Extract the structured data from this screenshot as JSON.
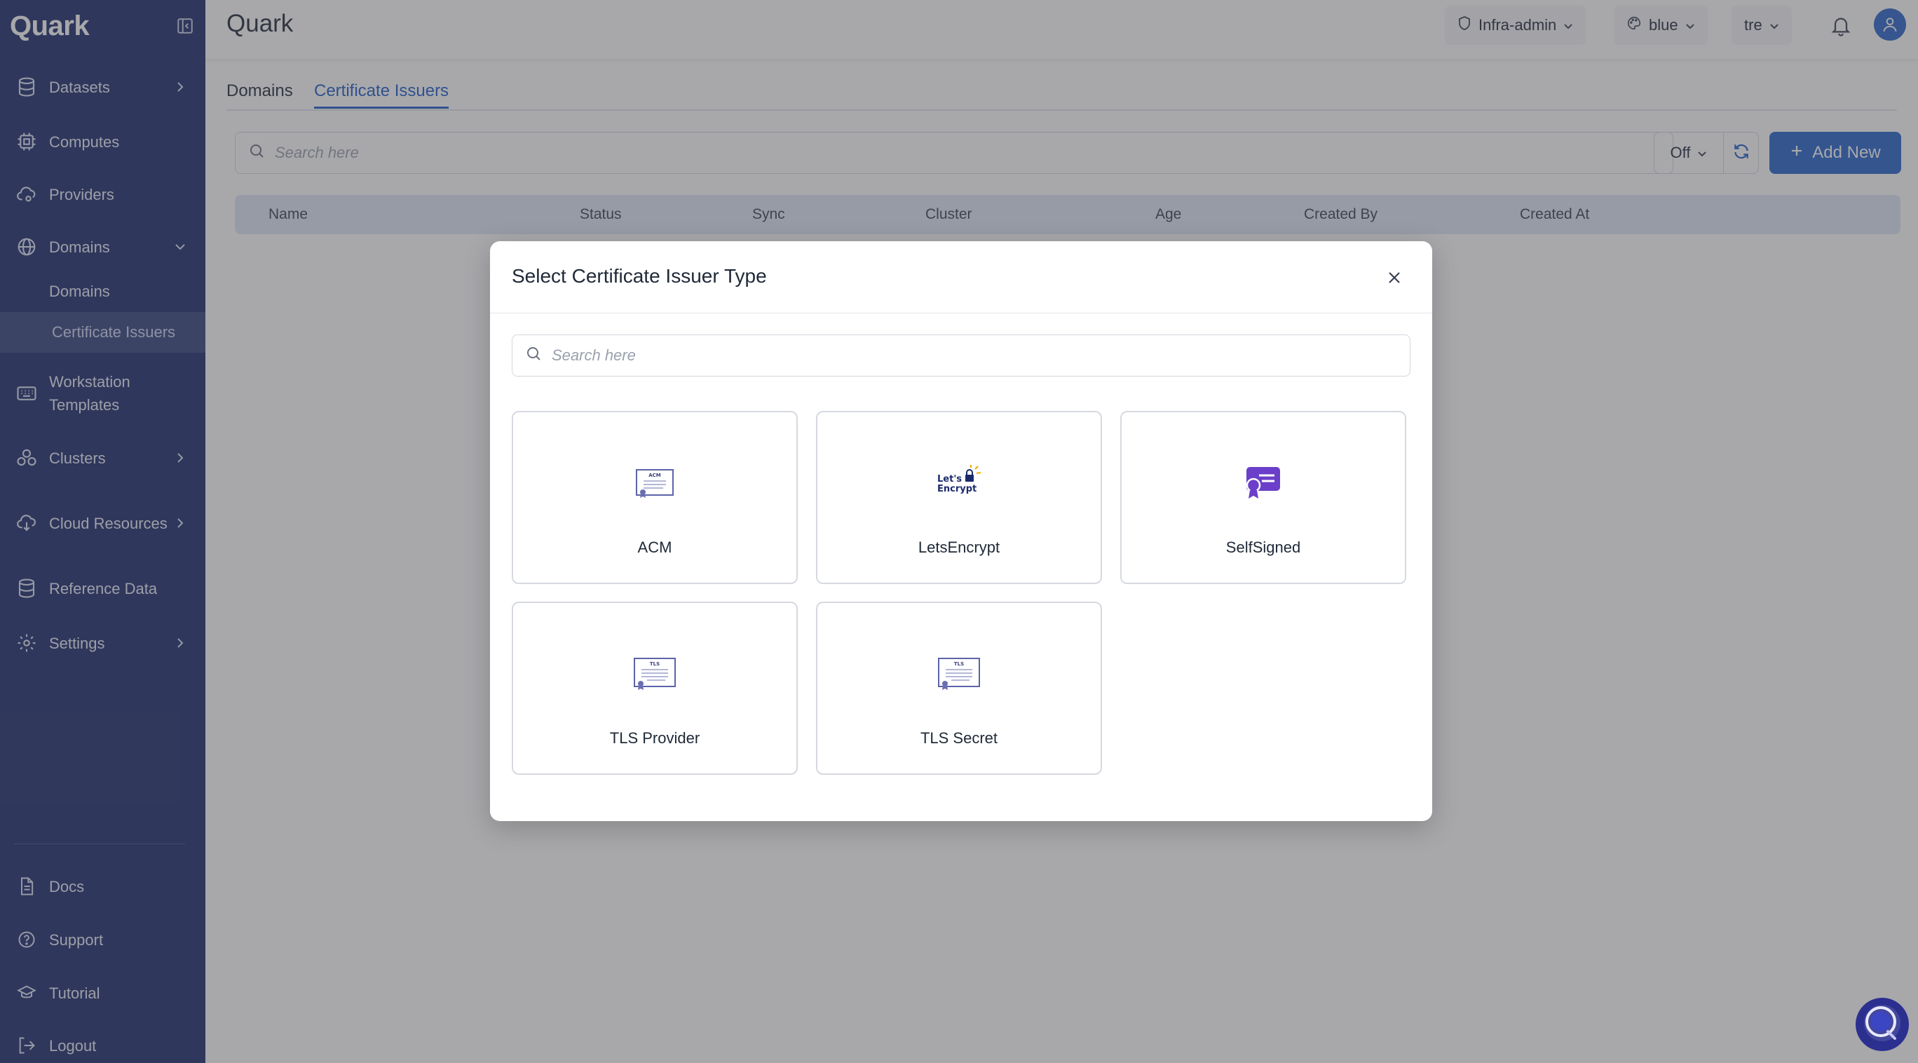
{
  "app": {
    "name": "Quark"
  },
  "sidebar": {
    "items": [
      {
        "label": "Datasets",
        "icon": "database-icon"
      },
      {
        "label": "Computes",
        "icon": "cpu-icon"
      },
      {
        "label": "Providers",
        "icon": "cloud-settings-icon"
      },
      {
        "label": "Domains",
        "icon": "globe-icon"
      },
      {
        "label": "Workstation Templates",
        "icon": "keyboard-icon"
      },
      {
        "label": "Clusters",
        "icon": "cluster-icon"
      },
      {
        "label": "Cloud Resources",
        "icon": "cloud-download-icon"
      },
      {
        "label": "Reference Data",
        "icon": "database-icon"
      },
      {
        "label": "Settings",
        "icon": "gear-icon"
      }
    ],
    "sub_items": [
      {
        "label": "Domains"
      },
      {
        "label": "Certificate Issuers"
      }
    ],
    "bottom": [
      {
        "label": "Docs",
        "icon": "document-icon"
      },
      {
        "label": "Support",
        "icon": "help-circle-icon"
      },
      {
        "label": "Tutorial",
        "icon": "graduation-cap-icon"
      },
      {
        "label": "Logout",
        "icon": "logout-icon"
      }
    ]
  },
  "header": {
    "title": "Quark",
    "role": "Infra-admin",
    "theme": "blue",
    "workspace": "tre"
  },
  "tabs": [
    {
      "label": "Domains"
    },
    {
      "label": "Certificate Issuers"
    }
  ],
  "toolbar": {
    "search_placeholder": "Search here",
    "auto_refresh": "Off",
    "add_label": "Add New"
  },
  "table": {
    "columns": [
      "Name",
      "Status",
      "Sync",
      "Cluster",
      "Age",
      "Created By",
      "Created At"
    ]
  },
  "modal": {
    "title": "Select Certificate Issuer Type",
    "search_placeholder": "Search here",
    "options": [
      {
        "label": "ACM",
        "icon": "acm-certificate-icon",
        "icon_text": "ACM"
      },
      {
        "label": "LetsEncrypt",
        "icon": "letsencrypt-logo-icon",
        "icon_text": "Let's Encrypt"
      },
      {
        "label": "SelfSigned",
        "icon": "self-signed-certificate-icon"
      },
      {
        "label": "TLS Provider",
        "icon": "tls-certificate-icon",
        "icon_text": "TLS"
      },
      {
        "label": "TLS Secret",
        "icon": "tls-certificate-icon",
        "icon_text": "TLS"
      }
    ]
  },
  "colors": {
    "sidebar_bg": "#1c2b6b",
    "accent": "#1e5bc6",
    "primary_button": "#2563c9",
    "selfsigned_purple": "#6b3fc9"
  }
}
